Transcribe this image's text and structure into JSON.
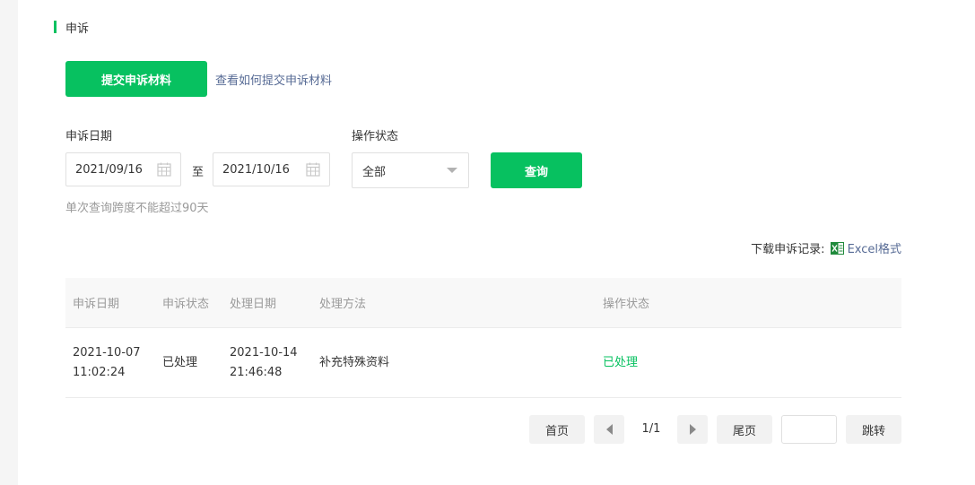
{
  "section": {
    "title": "申诉"
  },
  "actions": {
    "submit_label": "提交申诉材料",
    "help_link": "查看如何提交申诉材料"
  },
  "filters": {
    "date_label": "申诉日期",
    "start_date": "2021/09/16",
    "separator": "至",
    "end_date": "2021/10/16",
    "status_label": "操作状态",
    "status_value": "全部",
    "query_label": "查询",
    "hint": "单次查询跨度不能超过90天"
  },
  "download": {
    "label": "下载申诉记录:",
    "link": "Excel格式"
  },
  "table": {
    "headers": [
      "申诉日期",
      "申诉状态",
      "处理日期",
      "处理方法",
      "操作状态"
    ],
    "rows": [
      {
        "appeal_date": "2021-10-07 11:02:24",
        "appeal_status": "已处理",
        "process_date": "2021-10-14 21:46:48",
        "method": "补充特殊资料",
        "op_status": "已处理"
      }
    ]
  },
  "pagination": {
    "first": "首页",
    "info": "1/1",
    "last": "尾页",
    "jump_value": "",
    "jump": "跳转"
  },
  "colors": {
    "accent": "#07c160",
    "link": "#576b95"
  }
}
